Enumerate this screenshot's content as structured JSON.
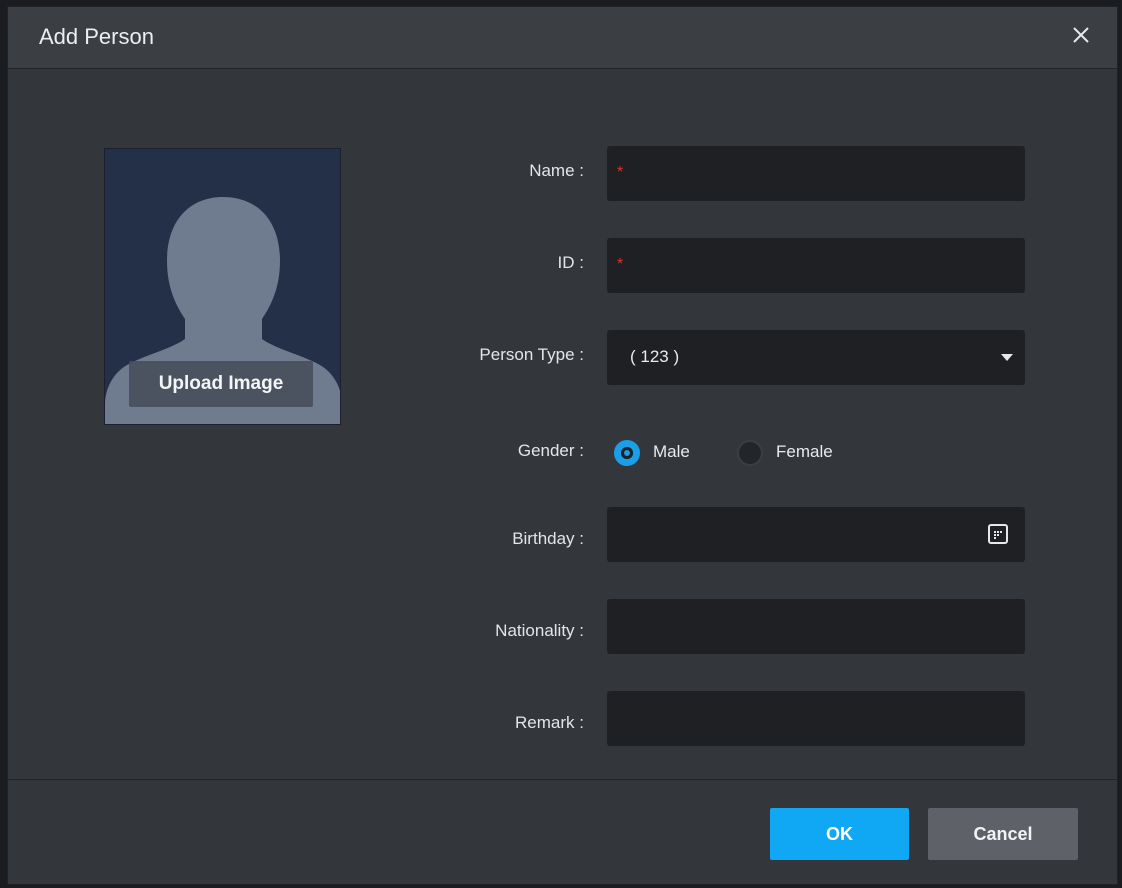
{
  "dialog": {
    "title": "Add Person",
    "close_icon": "close-icon"
  },
  "avatar": {
    "upload_label": "Upload Image",
    "placeholder_icon": "person-silhouette-icon"
  },
  "form": {
    "name_label": "Name :",
    "name_required_mark": "*",
    "name_value": "",
    "id_label": "ID :",
    "id_required_mark": "*",
    "id_value": "",
    "person_type_label": "Person Type :",
    "person_type_value": "( 123 )",
    "gender_label": "Gender :",
    "gender_options": [
      "Male",
      "Female"
    ],
    "gender_selected": "Male",
    "birthday_label": "Birthday :",
    "birthday_value": "",
    "nationality_label": "Nationality :",
    "nationality_value": "",
    "remark_label": "Remark :",
    "remark_value": ""
  },
  "buttons": {
    "ok": "OK",
    "cancel": "Cancel"
  },
  "colors": {
    "accent": "#10a7f5",
    "required": "#e0302a",
    "dialog_bg": "#33363b",
    "field_bg": "#1f2023"
  }
}
